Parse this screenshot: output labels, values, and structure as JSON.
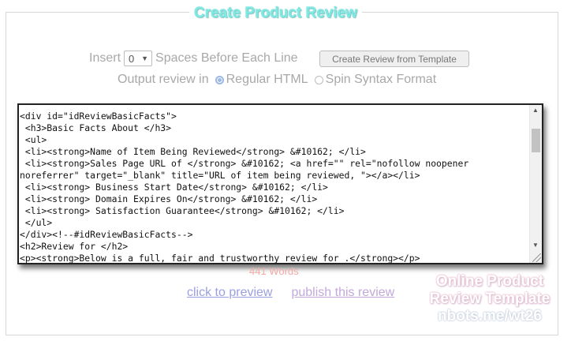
{
  "title": "Create Product Review",
  "insert_row": {
    "prefix": "Insert",
    "spaces_value": "0",
    "suffix": "Spaces Before Each Line"
  },
  "template_button": "Create Review from Template",
  "output_row": {
    "label": "Output review in",
    "option_html": "Regular HTML",
    "option_spin": "Spin Syntax Format",
    "selected": "Regular HTML"
  },
  "editor": {
    "content": "<div id=\"idReviewBasicFacts\">\n <h3>Basic Facts About </h3>\n <ul>\n <li><strong>Name of Item Being Reviewed</strong> &#10162; </li>\n <li><strong>Sales Page URL of </strong> &#10162; <a href=\"\" rel=\"nofollow noopener noreferrer\" target=\"_blank\" title=\"URL of item being reviewed, \"></a></li>\n <li><strong> Business Start Date</strong> &#10162; </li>\n <li><strong> Domain Expires On</strong> &#10162; </li>\n <li><strong> Satisfaction Guarantee</strong> &#10162; </li>\n </ul>\n</div><!--#idReviewBasicFacts-->\n<h2>Review for </h2>\n<p><strong>Below is a full, fair and trustworthy review for .</strong></p>"
  },
  "word_count": "441 Words",
  "links": {
    "preview": "click to preview",
    "publish": "publish this review"
  },
  "watermark": {
    "line1": "Online Product",
    "line2": "Review Template",
    "line3": "nbots.me/wt26"
  },
  "colors": {
    "title": "#7fe9e3",
    "word_count": "#f2a9a6",
    "preview_link": "#9aa0e0",
    "publish_link": "#c3a8da"
  }
}
